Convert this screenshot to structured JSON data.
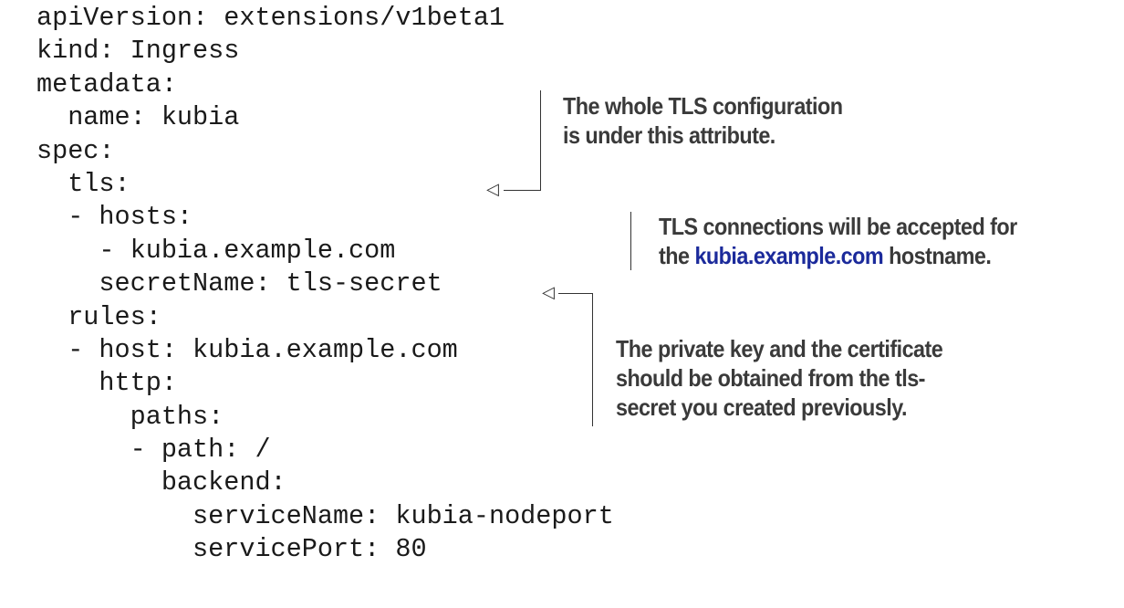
{
  "code": {
    "lines": [
      "apiVersion: extensions/v1beta1",
      "kind: Ingress",
      "metadata:",
      "  name: kubia",
      "spec:",
      "  tls:",
      "  - hosts:",
      "    - kubia.example.com",
      "    secretName: tls-secret",
      "  rules:",
      "  - host: kubia.example.com",
      "    http:",
      "      paths:",
      "      - path: /",
      "        backend:",
      "          serviceName: kubia-nodeport",
      "          servicePort: 80"
    ]
  },
  "annotations": {
    "tls": {
      "line1": "The whole TLS configuration",
      "line2": "is under this attribute."
    },
    "hosts": {
      "line1": "TLS connections will be accepted for",
      "line2_prefix": "the ",
      "line2_host": "kubia.example.com",
      "line2_suffix": " hostname."
    },
    "secret": {
      "line1": "The private key and the certificate",
      "line2": "should be obtained from the tls-",
      "line3": "secret you created previously."
    }
  },
  "colors": {
    "code_text": "#1a1a1a",
    "annotation_text": "#3a3a3a",
    "hostname_highlight": "#1b2a9b",
    "leader_lines": "#333333"
  },
  "icons": {
    "pointer": "open-left-arrowhead"
  }
}
